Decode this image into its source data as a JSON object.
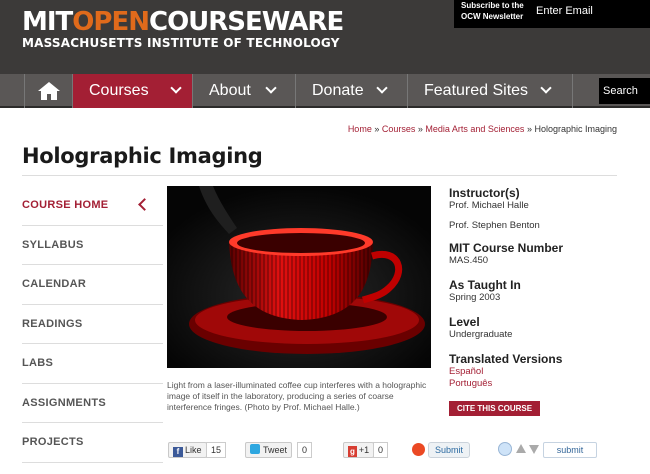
{
  "header": {
    "logo_mit": "MIT",
    "logo_open": "OPEN",
    "logo_courseware": "COURSEWARE",
    "logo_subtitle": "MASSACHUSETTS INSTITUTE OF TECHNOLOGY",
    "newsletter_label": "Subscribe to the OCW Newsletter",
    "newsletter_placeholder": "Enter Email",
    "search_placeholder": "Search"
  },
  "nav": {
    "items": [
      {
        "label": "Courses"
      },
      {
        "label": "About"
      },
      {
        "label": "Donate"
      },
      {
        "label": "Featured Sites"
      }
    ]
  },
  "breadcrumb": {
    "home": "Home",
    "sep": " » ",
    "courses": "Courses",
    "department": "Media Arts and Sciences",
    "current": "Holographic Imaging"
  },
  "page": {
    "title": "Holographic Imaging",
    "caption": "Light from a laser-illuminated coffee cup interferes with a holographic image of itself in the laboratory, producing a series of coarse interference fringes. (Photo by Prof. Michael Halle.)"
  },
  "sidebar": {
    "items": [
      {
        "label": "COURSE HOME"
      },
      {
        "label": "SYLLABUS"
      },
      {
        "label": "CALENDAR"
      },
      {
        "label": "READINGS"
      },
      {
        "label": "LABS"
      },
      {
        "label": "ASSIGNMENTS"
      },
      {
        "label": "PROJECTS"
      }
    ]
  },
  "info": {
    "instructors_heading": "Instructor(s)",
    "instructor_1": "Prof. Michael Halle",
    "instructor_2": "Prof. Stephen Benton",
    "number_heading": "MIT Course Number",
    "number": "MAS.450",
    "taught_heading": "As Taught In",
    "taught": "Spring 2003",
    "level_heading": "Level",
    "level": "Undergraduate",
    "translated_heading": "Translated Versions",
    "translation_1": "Español",
    "translation_2": "Português",
    "cite_label": "CITE THIS COURSE"
  },
  "social": {
    "fb_label": "Like",
    "fb_count": "15",
    "tweet_label": "Tweet",
    "tweet_count": "0",
    "gplus_label": "+1",
    "gplus_count": "0",
    "stumble_label": "Submit",
    "reddit_label": "submit"
  },
  "colors": {
    "accent": "#a31f34",
    "logo_orange": "#e06a1b",
    "header_bg": "#3c3a39",
    "nav_bg": "#5a5756"
  }
}
